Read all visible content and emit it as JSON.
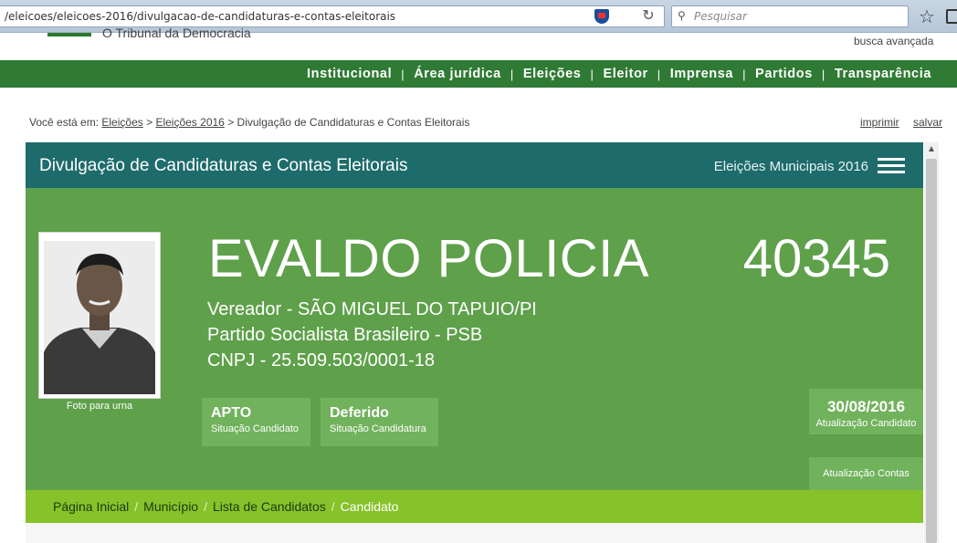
{
  "browser": {
    "url": "/eleicoes/eleicoes-2016/divulgacao-de-candidaturas-e-contas-eleitorais",
    "search_placeholder": "Pesquisar"
  },
  "header": {
    "tagline": "O Tribunal da Democracia",
    "advanced_search": "busca avançada"
  },
  "mainnav": {
    "items": [
      "Institucional",
      "Área jurídica",
      "Eleições",
      "Eleitor",
      "Imprensa",
      "Partidos",
      "Transparência"
    ]
  },
  "breadcrumb": {
    "prefix": "Você está em:",
    "links": [
      "Eleições",
      "Eleições 2016"
    ],
    "current": "Divulgação de Candidaturas e Contas Eleitorais",
    "separator": ">"
  },
  "tools": {
    "print": "imprimir",
    "save": "salvar"
  },
  "panel": {
    "title": "Divulgação de Candidaturas e Contas Eleitorais",
    "subtitle": "Eleições Municipais 2016"
  },
  "candidate": {
    "photo_caption": "Foto para urna",
    "name": "EVALDO POLICIA",
    "number": "40345",
    "role_line": "Vereador - SÃO MIGUEL DO TAPUIO/PI",
    "party_line": "Partido Socialista Brasileiro - PSB",
    "cnpj_line": "CNPJ - 25.509.503/0001-18"
  },
  "status": {
    "candidate_status": "APTO",
    "candidate_status_label": "Situação Candidato",
    "candidacy_status": "Deferido",
    "candidacy_status_label": "Situação Candidatura",
    "update_date": "30/08/2016",
    "update_date_label": "Atualização Candidato",
    "accounts_label": "Atualização Contas"
  },
  "subnav": {
    "items": [
      "Página Inicial",
      "Município",
      "Lista de Candidatos",
      "Candidato"
    ],
    "separator": "/"
  },
  "colors": {
    "nav_green": "#2f7a34",
    "panel_teal": "#1e6b6b",
    "panel_green": "#5fa04b",
    "lime": "#86c22a"
  }
}
